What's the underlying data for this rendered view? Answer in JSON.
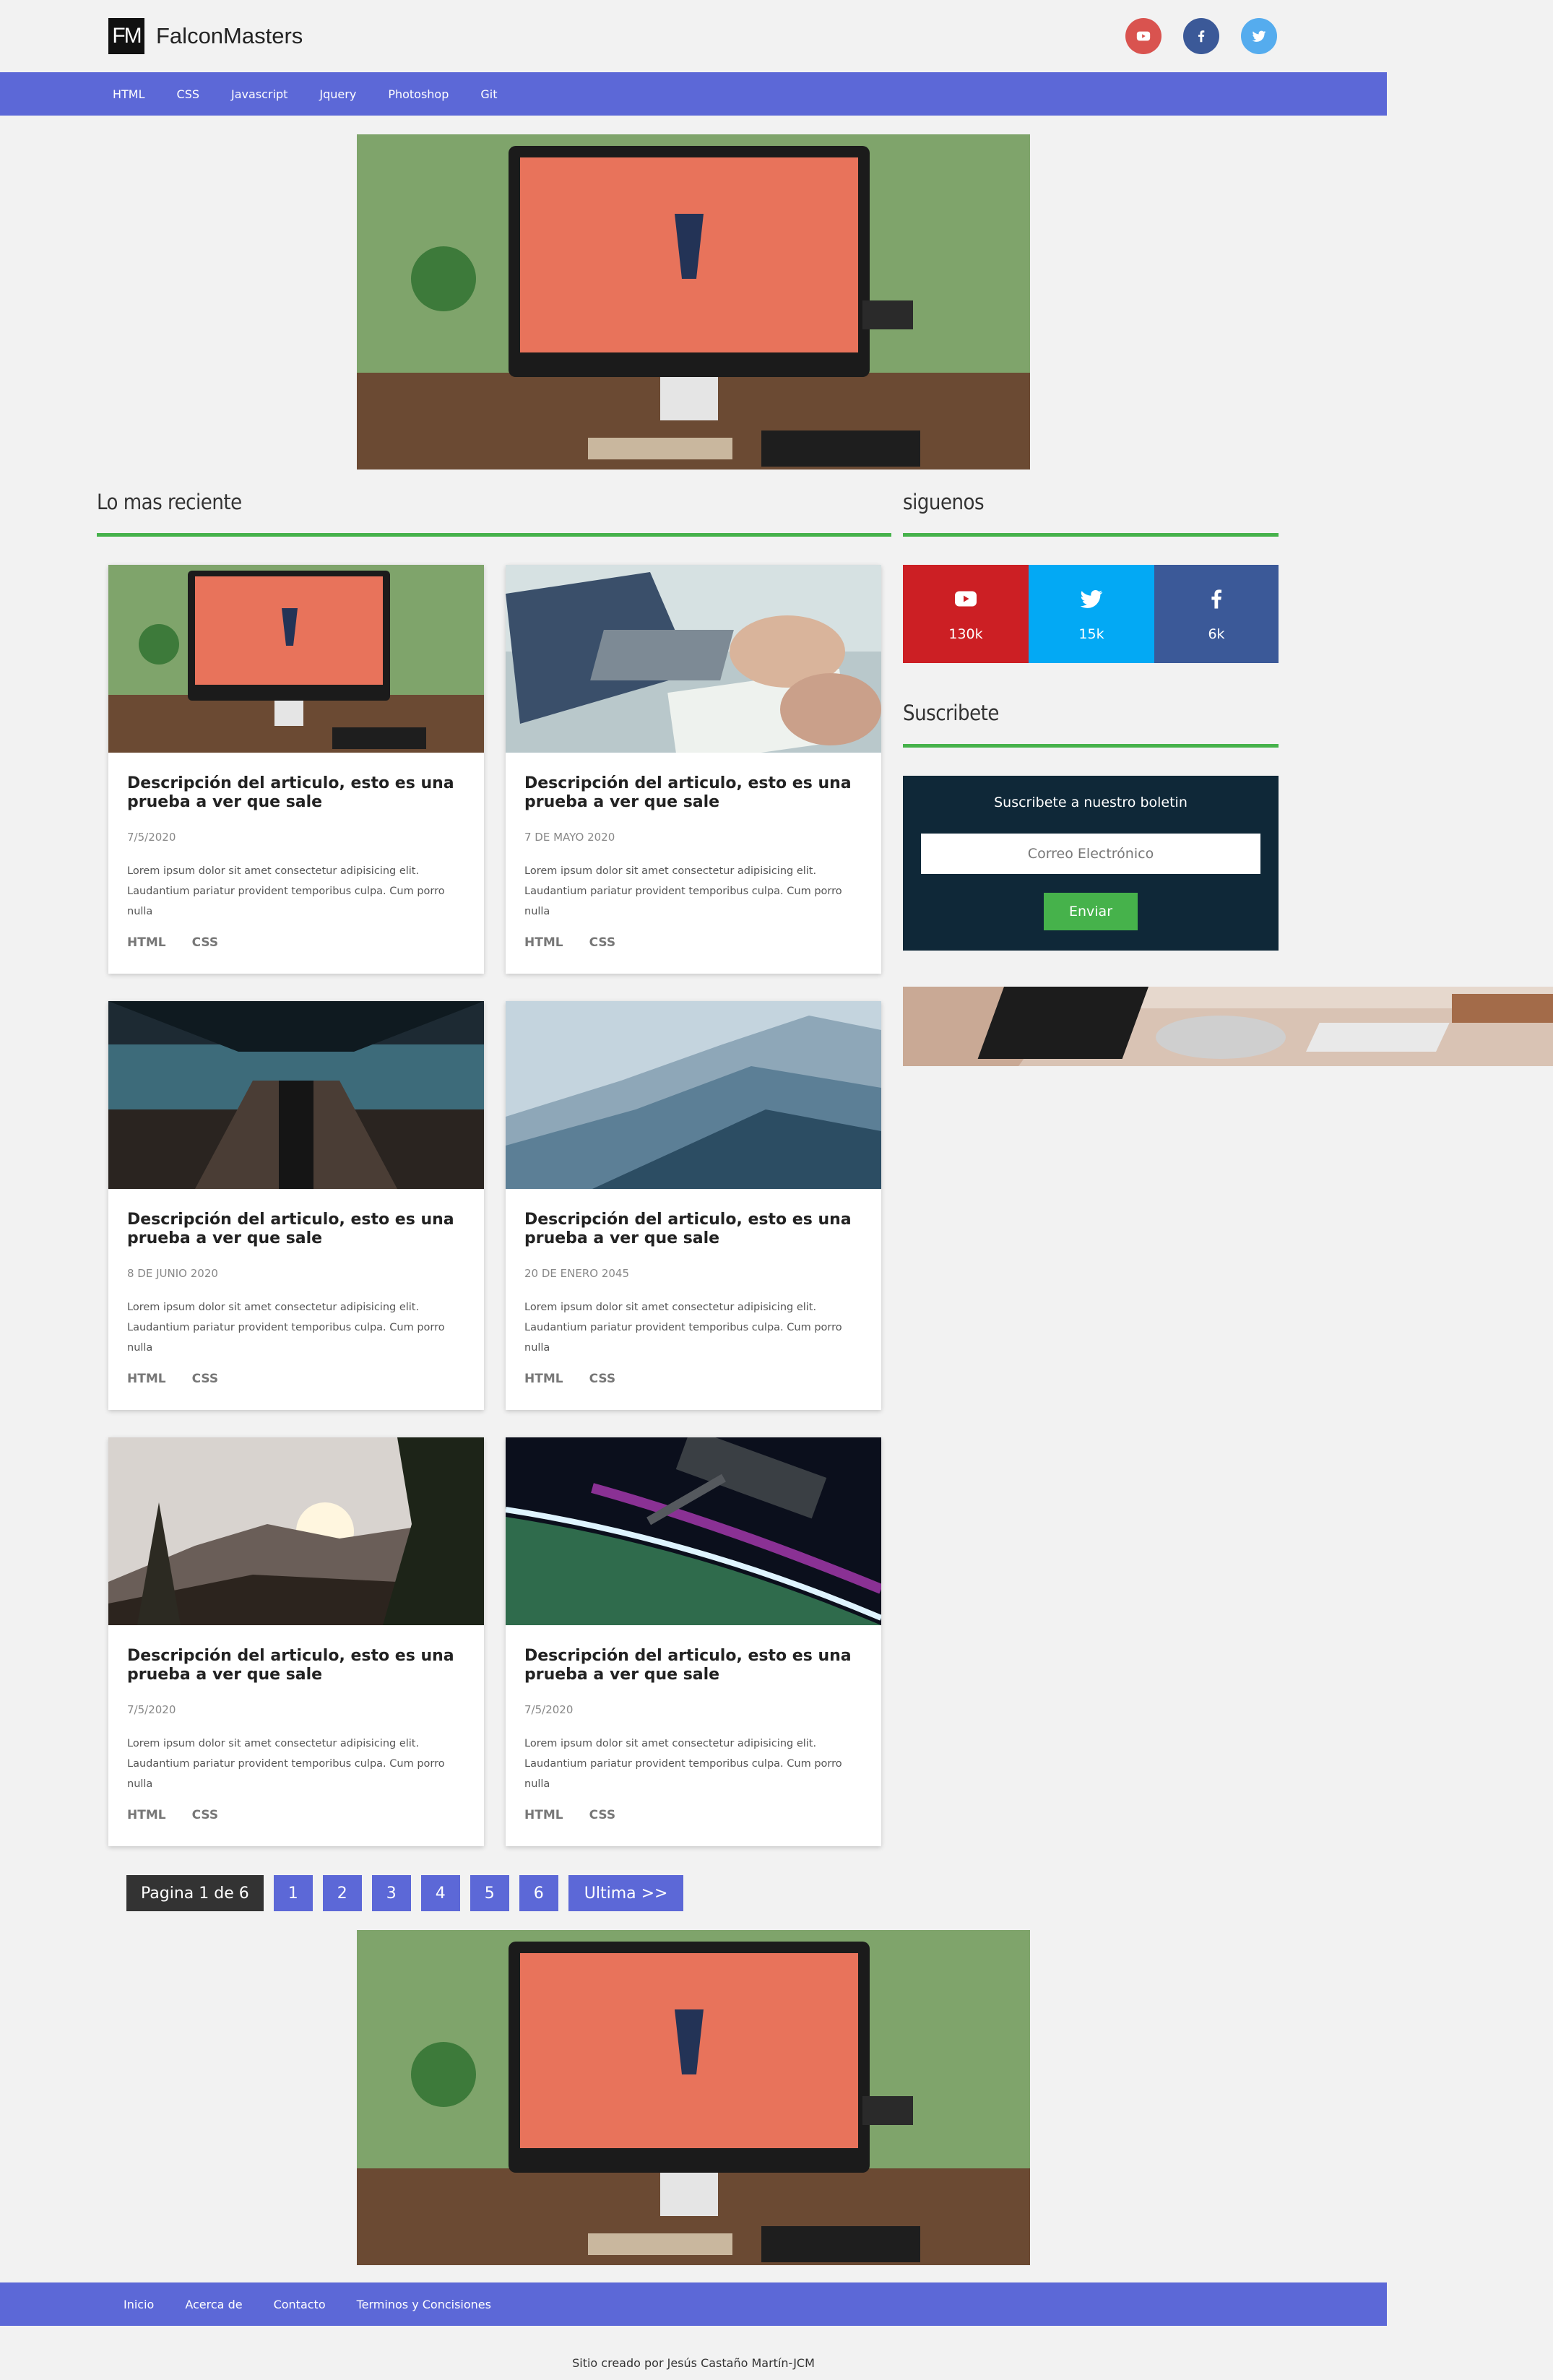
{
  "brand": {
    "mark": "FM",
    "name": "FalconMasters"
  },
  "colors": {
    "accent": "#5c68d7",
    "green": "#46b24b",
    "youtube": "#cc1f24",
    "twitter": "#03a9f4",
    "facebook": "#3b5998",
    "newsletter_bg": "#0f2838"
  },
  "header_social": [
    {
      "icon": "youtube-icon",
      "color": "#d9534f"
    },
    {
      "icon": "facebook-icon",
      "color": "#3b5998"
    },
    {
      "icon": "twitter-icon",
      "color": "#55acee"
    }
  ],
  "nav": [
    "HTML",
    "CSS",
    "Javascript",
    "Jquery",
    "Photoshop",
    "Git"
  ],
  "sections": {
    "latest": "Lo mas reciente",
    "follow": "siguenos",
    "subscribe": "Suscribete"
  },
  "social_counts": [
    {
      "icon": "youtube-icon",
      "count": "130k"
    },
    {
      "icon": "twitter-icon",
      "count": "15k"
    },
    {
      "icon": "facebook-icon",
      "count": "6k"
    }
  ],
  "cards": [
    {
      "title": "Descripción del articulo, esto es una prueba a ver que sale",
      "date": "7/5/2020",
      "text": "Lorem ipsum dolor sit amet consectetur adipisicing elit. Laudantium pariatur provident temporibus culpa. Cum porro nulla",
      "tags": [
        "HTML",
        "CSS"
      ],
      "image": "imac-desk-thumbnail"
    },
    {
      "title": "Descripción del articulo, esto es una prueba a ver que sale",
      "date": "7 DE MAYO 2020",
      "text": "Lorem ipsum dolor sit amet consectetur adipisicing elit. Laudantium pariatur provident temporibus culpa. Cum porro nulla",
      "tags": [
        "HTML",
        "CSS"
      ],
      "image": "laptop-notes-thumbnail"
    },
    {
      "title": "Descripción del articulo, esto es una prueba a ver que sale",
      "date": "8 DE JUNIO 2020",
      "text": "Lorem ipsum dolor sit amet consectetur adipisicing elit. Laudantium pariatur provident temporibus culpa. Cum porro nulla",
      "tags": [
        "HTML",
        "CSS"
      ],
      "image": "escalator-thumbnail"
    },
    {
      "title": "Descripción del articulo, esto es una prueba a ver que sale",
      "date": "20 DE ENERO 2045",
      "text": "Lorem ipsum dolor sit amet consectetur adipisicing elit. Laudantium pariatur provident temporibus culpa. Cum porro nulla",
      "tags": [
        "HTML",
        "CSS"
      ],
      "image": "mountains-thumbnail"
    },
    {
      "title": "Descripción del articulo, esto es una prueba a ver que sale",
      "date": "7/5/2020",
      "text": "Lorem ipsum dolor sit amet consectetur adipisicing elit. Laudantium pariatur provident temporibus culpa. Cum porro nulla",
      "tags": [
        "HTML",
        "CSS"
      ],
      "image": "sunset-forest-thumbnail"
    },
    {
      "title": "Descripción del articulo, esto es una prueba a ver que sale",
      "date": "7/5/2020",
      "text": "Lorem ipsum dolor sit amet consectetur adipisicing elit. Laudantium pariatur provident temporibus culpa. Cum porro nulla",
      "tags": [
        "HTML",
        "CSS"
      ],
      "image": "space-station-thumbnail"
    }
  ],
  "newsletter": {
    "title": "Suscribete a nuestro boletin",
    "placeholder": "Correo Electrónico",
    "button": "Enviar"
  },
  "pagination": {
    "info": "Pagina 1 de 6",
    "pages": [
      "1",
      "2",
      "3",
      "4",
      "5",
      "6"
    ],
    "last": "Ultima >>"
  },
  "footer_nav": [
    "Inicio",
    "Acerca de",
    "Contacto",
    "Terminos y Concisiones"
  ],
  "credit": "Sitio creado por Jesús Castaño Martín-JCM"
}
